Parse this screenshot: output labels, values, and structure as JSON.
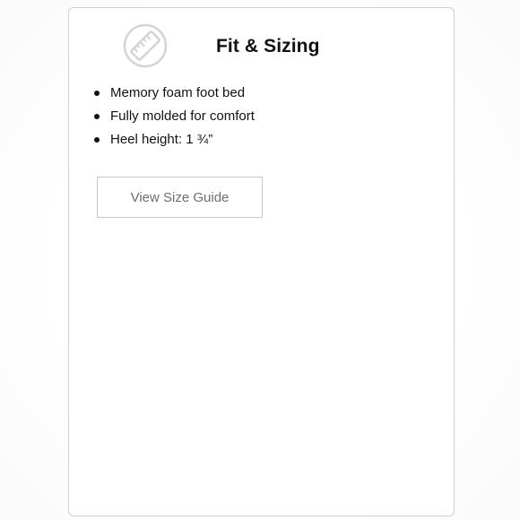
{
  "card": {
    "title": "Fit & Sizing",
    "icon": "ruler-icon",
    "features": [
      "Memory foam foot bed",
      "Fully molded for comfort",
      "Heel height: 1 ¾”"
    ],
    "button_label": "View Size Guide"
  },
  "colors": {
    "border": "#cfcfcf",
    "icon": "#d4d4d4",
    "button_text": "#6a6f73",
    "text": "#111111"
  }
}
